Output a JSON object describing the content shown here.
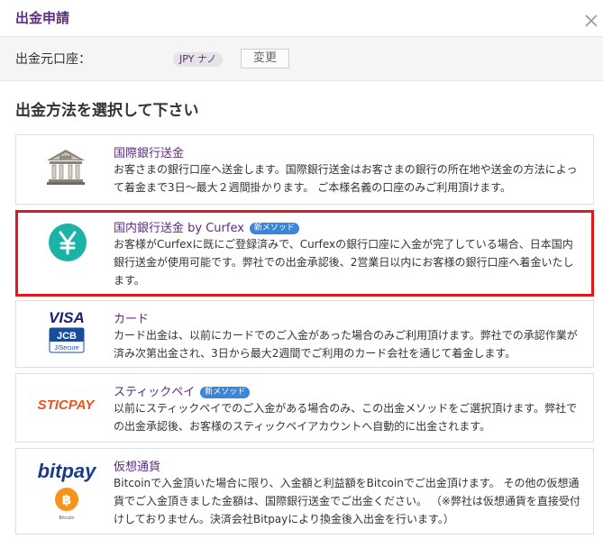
{
  "dialog": {
    "title": "出金申請"
  },
  "account": {
    "label": "出金元口座：",
    "badge": "JPY ナノ",
    "change_button": "変更"
  },
  "section_title": "出金方法を選択して下さい",
  "methods": [
    {
      "name": "国際銀行送金",
      "new_badge": "",
      "icon": "bank-icon",
      "desc": "お客さまの銀行口座へ送金します。国際銀行送金はお客さまの銀行の所在地や送金の方法によって着金まで3日〜最大２週間掛かります。 ご本様名義の口座のみご利用頂けます。"
    },
    {
      "name": "国内銀行送金 by Curfex",
      "new_badge": "新メソッド",
      "icon": "yen-icon",
      "desc": "お客様がCurfexに既にご登録済みで、Curfexの銀行口座に入金が完了している場合、日本国内銀行送金が使用可能です。弊社での出金承認後、2営業日以内にお客様の銀行口座へ着金いたします。"
    },
    {
      "name": "カード",
      "new_badge": "",
      "icon": "card-logos-icon",
      "desc": "カード出金は、以前にカードでのご入金があった場合のみご利用頂けます。弊社での承認作業が済み次第出金され、3日から最大2週間でご利用のカード会社を通じて着金します。"
    },
    {
      "name": "スティックペイ",
      "new_badge": "新メソッド",
      "icon": "sticpay-logo",
      "desc": "以前にスティックペイでのご入金がある場合のみ、この出金メソッドをご選択頂けます。弊社での出金承認後、お客様のスティックペイアカウントへ自動的に出金されます。"
    },
    {
      "name": "仮想通貨",
      "new_badge": "",
      "icon": "bitpay-logo",
      "desc": "Bitcoinで入金頂いた場合に限り、入金額と利益額をBitcoinでご出金頂けます。 その他の仮想通貨でご入金頂きました金額は、国際銀行送金でご出金ください。 （※弊社は仮想通貨を直接受付けしておりません。決済会社Bitpayにより換金後入出金を行います。）"
    }
  ],
  "logos": {
    "visa": "VISA",
    "jcb": "JCB",
    "jcb_sub": "J/Secure",
    "sticpay": "STICPAY",
    "bitpay": "bitpay",
    "bitcoin_sub": "Bitcoin",
    "bank": "BANK"
  },
  "colors": {
    "accent": "#5a2d82",
    "selected_border": "#e0191e",
    "new_badge": "#3a86d8",
    "yen": "#1ab3a6",
    "bitcoin": "#f7931a",
    "sticpay": "#e8531e",
    "bitpay": "#1a3b8b"
  }
}
